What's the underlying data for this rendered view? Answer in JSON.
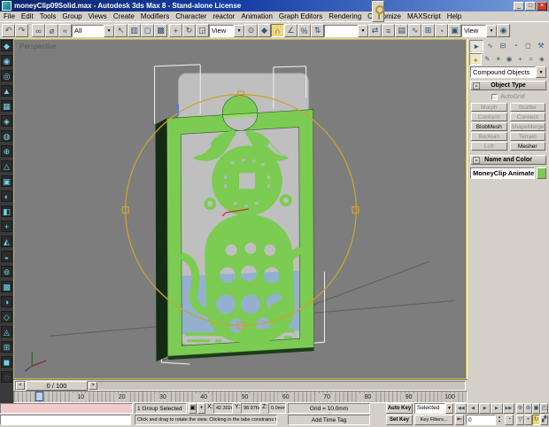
{
  "window": {
    "title": "moneyClip09Solid.max - Autodesk 3ds Max 8 - Stand-alone License",
    "minimize": "_",
    "restore": "□",
    "close": "×"
  },
  "menu": {
    "items": [
      "File",
      "Edit",
      "Tools",
      "Group",
      "Views",
      "Create",
      "Modifiers",
      "Character",
      "reactor",
      "Animation",
      "Graph Editors",
      "Rendering",
      "Customize",
      "MAXScript",
      "Help"
    ]
  },
  "toolbar": {
    "group1": [
      {
        "n": "undo-icon",
        "g": "↶"
      },
      {
        "n": "redo-icon",
        "g": "↷"
      }
    ],
    "group2": [
      {
        "n": "select-and-link-icon",
        "g": "∞"
      },
      {
        "n": "unlink-selection-icon",
        "g": "ø"
      },
      {
        "n": "bind-to-space-warp-icon",
        "g": "≈"
      }
    ],
    "selection_filter": "All",
    "group3": [
      {
        "n": "select-object-icon",
        "g": "↖"
      },
      {
        "n": "select-by-name-icon",
        "g": "▥"
      },
      {
        "n": "rectangular-selection-region-icon",
        "g": "◻"
      },
      {
        "n": "window-crossing-icon",
        "g": "▩"
      }
    ],
    "group4": [
      {
        "n": "select-and-move-icon",
        "g": "+"
      },
      {
        "n": "select-and-rotate-icon",
        "g": "↻"
      },
      {
        "n": "select-and-scale-icon",
        "g": "◲"
      }
    ],
    "coordinate_system": "View",
    "group5": [
      {
        "n": "use-pivot-center-icon",
        "g": "⊙"
      },
      {
        "n": "select-and-manipulate-icon",
        "g": "◆"
      }
    ],
    "group6": [
      {
        "n": "snap-toggle-icon",
        "g": "∩",
        "act": true
      },
      {
        "n": "angle-snap-icon",
        "g": "∠"
      },
      {
        "n": "percent-snap-icon",
        "g": "%"
      },
      {
        "n": "spinner-snap-icon",
        "g": "⇅"
      }
    ],
    "named_selection_sets": "",
    "group7": [
      {
        "n": "mirror-icon",
        "g": "⇄"
      },
      {
        "n": "align-icon",
        "g": "≡"
      },
      {
        "n": "layer-manager-icon",
        "g": "▤"
      },
      {
        "n": "curve-editor-icon",
        "g": "∿"
      },
      {
        "n": "schematic-view-icon",
        "g": "⊞"
      },
      {
        "n": "material-editor-icon",
        "g": "◔"
      },
      {
        "n": "render-scene-icon",
        "g": "▣"
      }
    ],
    "render_type": "View",
    "group8": [
      {
        "n": "quick-render-icon",
        "g": "◉"
      }
    ],
    "dd_arrow": "▼"
  },
  "left_toolbar": {
    "buttons": [
      "◆",
      "◉",
      "◎",
      "▲",
      "▦",
      "◈",
      "◍",
      "⊕",
      "△",
      "▣",
      "◐",
      "◧",
      "+",
      "◭",
      "◒",
      "⊚",
      "▩",
      "◑",
      "◇",
      "◬",
      "⊞",
      "◼",
      "◌"
    ]
  },
  "viewport": {
    "label": "Perspective"
  },
  "command_panel": {
    "tabs": [
      {
        "n": "tab-create",
        "g": "►",
        "act": true
      },
      {
        "n": "tab-modify",
        "g": "∿"
      },
      {
        "n": "tab-hierarchy",
        "g": "⊟"
      },
      {
        "n": "tab-motion",
        "g": "◔"
      },
      {
        "n": "tab-display",
        "g": "◻"
      },
      {
        "n": "tab-utilities",
        "g": "⚒"
      }
    ],
    "categories": [
      {
        "n": "category-geometry",
        "g": "●",
        "act": true
      },
      {
        "n": "category-shapes",
        "g": "✎"
      },
      {
        "n": "category-lights",
        "g": "☀"
      },
      {
        "n": "category-cameras",
        "g": "◉"
      },
      {
        "n": "category-helpers",
        "g": "+"
      },
      {
        "n": "category-space-warps",
        "g": "≈"
      },
      {
        "n": "category-systems",
        "g": "◈"
      }
    ],
    "subcategory": "Compound Objects",
    "object_type": {
      "minus": "-",
      "title": "Object Type",
      "autogrid": "AutoGrid",
      "buttons": [
        {
          "label": "Morph",
          "dis": true
        },
        {
          "label": "Scatter",
          "dis": true
        },
        {
          "label": "Conform",
          "dis": true
        },
        {
          "label": "Connect",
          "dis": true
        },
        {
          "label": "BlobMesh",
          "dis": false
        },
        {
          "label": "ShapeMerge",
          "dis": true
        },
        {
          "label": "Boolean",
          "dis": true
        },
        {
          "label": "Terrain",
          "dis": true
        },
        {
          "label": "Loft",
          "dis": true
        },
        {
          "label": "Mesher",
          "dis": false
        }
      ]
    },
    "name_color": {
      "minus": "-",
      "title": "Name and Color",
      "object_name": "MoneyClip Animate",
      "color": "#7CCB52"
    }
  },
  "timeline": {
    "slider_label": "0 / 100",
    "prev": "<",
    "next": ">",
    "ruler": [
      "10",
      "20",
      "30",
      "40",
      "50",
      "60",
      "70",
      "80",
      "90",
      "100"
    ]
  },
  "status": {
    "selection": "1 Group Selected",
    "lock": "▣",
    "offset": "+",
    "x_label": "X:",
    "y_label": "Y:",
    "z_label": "Z:",
    "x": "42.302mm",
    "y": "98.976mm",
    "z": "0.0mm",
    "grid": "Grid = 10.0mm",
    "add_time_tag": "Add Time Tag",
    "prompt": "Click and drag to rotate the view. Clicking in the tabs constrains the rotation"
  },
  "animation": {
    "auto_key": "Auto Key",
    "set_key": "Set Key",
    "selected_dropdown": "Selected",
    "key_filters": "Key Filters...",
    "frame": "0",
    "spin_up": "▲",
    "spin_down": "▼",
    "key_mode": "⇤",
    "time_config": "◔",
    "playback": [
      {
        "n": "go-to-start-button",
        "g": "◀◀"
      },
      {
        "n": "previous-frame-button",
        "g": "◀"
      },
      {
        "n": "play-button",
        "g": "▶"
      },
      {
        "n": "next-frame-button",
        "g": "▶"
      },
      {
        "n": "go-to-end-button",
        "g": "▶▶"
      }
    ],
    "nav": [
      {
        "n": "zoom-button",
        "g": "⊕"
      },
      {
        "n": "zoom-all-button",
        "g": "⊛"
      },
      {
        "n": "zoom-extents-button",
        "g": "▣"
      },
      {
        "n": "zoom-extents-all-button",
        "g": "◰"
      },
      {
        "n": "field-of-view-button",
        "g": "▽"
      },
      {
        "n": "pan-button",
        "g": "+"
      },
      {
        "n": "arc-rotate-button",
        "g": "↻",
        "act": true
      },
      {
        "n": "min-max-toggle-button",
        "g": "▞"
      }
    ]
  },
  "colors": {
    "titlebar_blue": "#0A246A",
    "model_green": "#7CCB52",
    "gizmo_yellow": "#C9A433",
    "card_gray": "#BFBFBF",
    "water_blue": "#93B1CF",
    "ui_gray": "#D4D0C8"
  }
}
